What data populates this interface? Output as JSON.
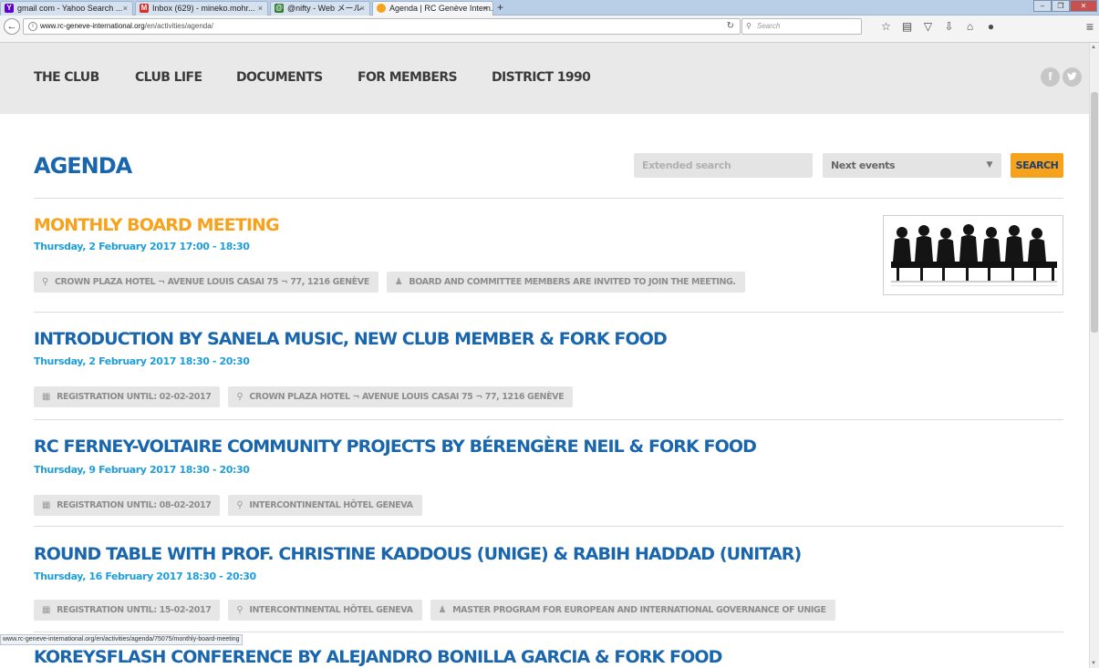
{
  "browser": {
    "tabs": [
      {
        "label": "gmail com - Yahoo Search ...",
        "favicon": "Y",
        "favicon_color": "#5f01d1"
      },
      {
        "label": "Inbox (629) - mineko.mohr...",
        "favicon": "M",
        "favicon_color": "#d93025"
      },
      {
        "label": "@nifty - Web メール",
        "favicon": "@",
        "favicon_color": "#2e7d32"
      },
      {
        "label": "Agenda | RC Genève Intern...",
        "favicon": "●",
        "favicon_color": "#f6a21d"
      }
    ],
    "url_host": "www.rc-geneve-international.org",
    "url_path": "/en/activities/agenda/",
    "search_placeholder": "Search",
    "status_url": "www.rc-geneve-international.org/en/activities/agenda/75075/monthly-board-meeting"
  },
  "site_nav": {
    "items": [
      "THE CLUB",
      "CLUB LIFE",
      "DOCUMENTS",
      "FOR MEMBERS",
      "DISTRICT 1990"
    ],
    "social": [
      "f",
      "t"
    ]
  },
  "agenda": {
    "title": "AGENDA",
    "search_placeholder": "Extended search",
    "filter_value": "Next events",
    "search_button": "SEARCH"
  },
  "events": [
    {
      "title": "MONTHLY BOARD MEETING",
      "date": "Thursday, 2 February 2017 17:00 - 18:30",
      "tags": [
        {
          "icon": "location-icon",
          "text": "CROWN PLAZA HOTEL ¬ AVENUE LOUIS CASAI 75 ¬ 77, 1216 GENÈVE"
        },
        {
          "icon": "user-icon",
          "text": "BOARD AND COMMITTEE MEMBERS ARE INVITED TO JOIN THE MEETING."
        }
      ]
    },
    {
      "title": "INTRODUCTION BY SANELA MUSIC, NEW CLUB MEMBER & FORK FOOD",
      "date": "Thursday, 2 February 2017 18:30 - 20:30",
      "tags": [
        {
          "icon": "calendar-icon",
          "text": "REGISTRATION UNTIL: 02-02-2017"
        },
        {
          "icon": "location-icon",
          "text": "CROWN PLAZA HOTEL ¬ AVENUE LOUIS CASAI 75 ¬ 77, 1216 GENÈVE"
        }
      ]
    },
    {
      "title": "RC FERNEY-VOLTAIRE COMMUNITY PROJECTS BY BÉRENGÈRE NEIL & FORK FOOD",
      "date": "Thursday, 9 February 2017 18:30 - 20:30",
      "tags": [
        {
          "icon": "calendar-icon",
          "text": "REGISTRATION UNTIL: 08-02-2017"
        },
        {
          "icon": "location-icon",
          "text": "INTERCONTINENTAL HÔTEL GENEVA"
        }
      ]
    },
    {
      "title": "ROUND TABLE WITH PROF. CHRISTINE KADDOUS (UNIGE) & RABIH HADDAD (UNITAR)",
      "date": "Thursday, 16 February 2017 18:30 - 20:30",
      "tags": [
        {
          "icon": "calendar-icon",
          "text": "REGISTRATION UNTIL: 15-02-2017"
        },
        {
          "icon": "location-icon",
          "text": "INTERCONTINENTAL HÔTEL GENEVA"
        },
        {
          "icon": "user-icon",
          "text": "MASTER PROGRAM FOR EUROPEAN AND INTERNATIONAL GOVERNANCE OF UNIGE"
        }
      ]
    },
    {
      "title": "KOREYSFLASH CONFERENCE BY ALEJANDRO BONILLA GARCIA & FORK FOOD",
      "date": "",
      "tags": []
    }
  ]
}
